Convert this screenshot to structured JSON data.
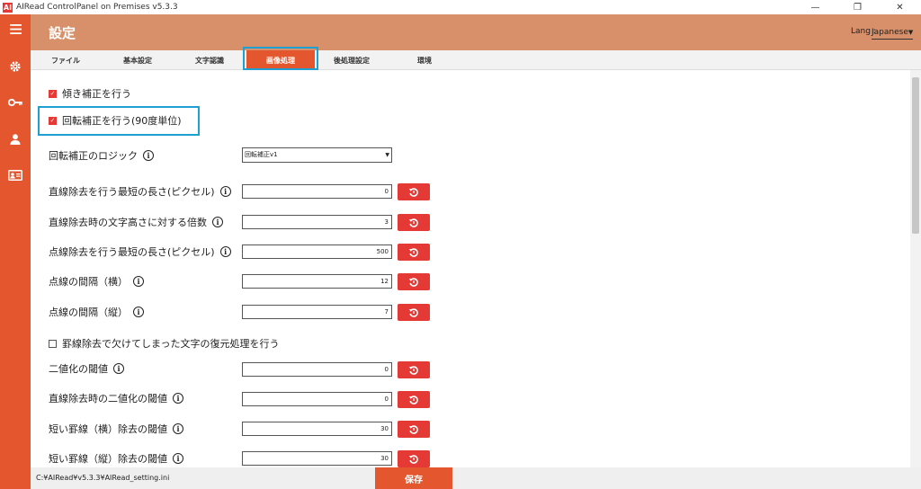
{
  "window": {
    "title": "AIRead ControlPanel on Premises v5.3.3",
    "logo": "AI",
    "minimize": "—",
    "maximize": "❐",
    "close": "✕"
  },
  "sidebar": {
    "icons": [
      "menu-icon",
      "gear-icon",
      "key-icon",
      "user-icon",
      "id-card-icon"
    ]
  },
  "header": {
    "title": "設定",
    "lang_label": "Lang :",
    "lang_value": "Japanese"
  },
  "tabs": [
    {
      "label": "ファイル"
    },
    {
      "label": "基本設定"
    },
    {
      "label": "文字認識"
    },
    {
      "label": "画像処理",
      "active": true
    },
    {
      "label": "後処理設定"
    },
    {
      "label": "環境"
    }
  ],
  "settings": {
    "deskew_label": "傾き補正を行う",
    "deskew_checked": true,
    "rotation_label": "回転補正を行う(90度単位)",
    "rotation_checked": true,
    "rotation_logic_label": "回転補正のロジック",
    "rotation_logic_value": "回転補正v1",
    "fields": [
      {
        "label": "直線除去を行う最短の長さ(ピクセル)",
        "value": "0"
      },
      {
        "label": "直線除去時の文字高さに対する倍数",
        "value": "3"
      },
      {
        "label": "点線除去を行う最短の長さ(ピクセル)",
        "value": "500"
      },
      {
        "label": "点線の間隔（横）",
        "value": "12"
      },
      {
        "label": "点線の間隔（縦）",
        "value": "7"
      }
    ],
    "restore_label": "罫線除去で欠けてしまった文字の復元処理を行う",
    "restore_checked": false,
    "fields2": [
      {
        "label": "二値化の閾値",
        "value": "0"
      },
      {
        "label": "直線除去時の二値化の閾値",
        "value": "0"
      },
      {
        "label": "短い罫線（横）除去の閾値",
        "value": "30"
      },
      {
        "label": "短い罫線（縦）除去の閾値",
        "value": "30"
      }
    ]
  },
  "footer": {
    "path": "C:¥AIRead¥v5.3.3¥AIRead_setting.ini",
    "save_label": "保存"
  },
  "colors": {
    "accent": "#e4572e",
    "header": "#d8906a",
    "highlight": "#1ea0d2",
    "button": "#e53935"
  }
}
